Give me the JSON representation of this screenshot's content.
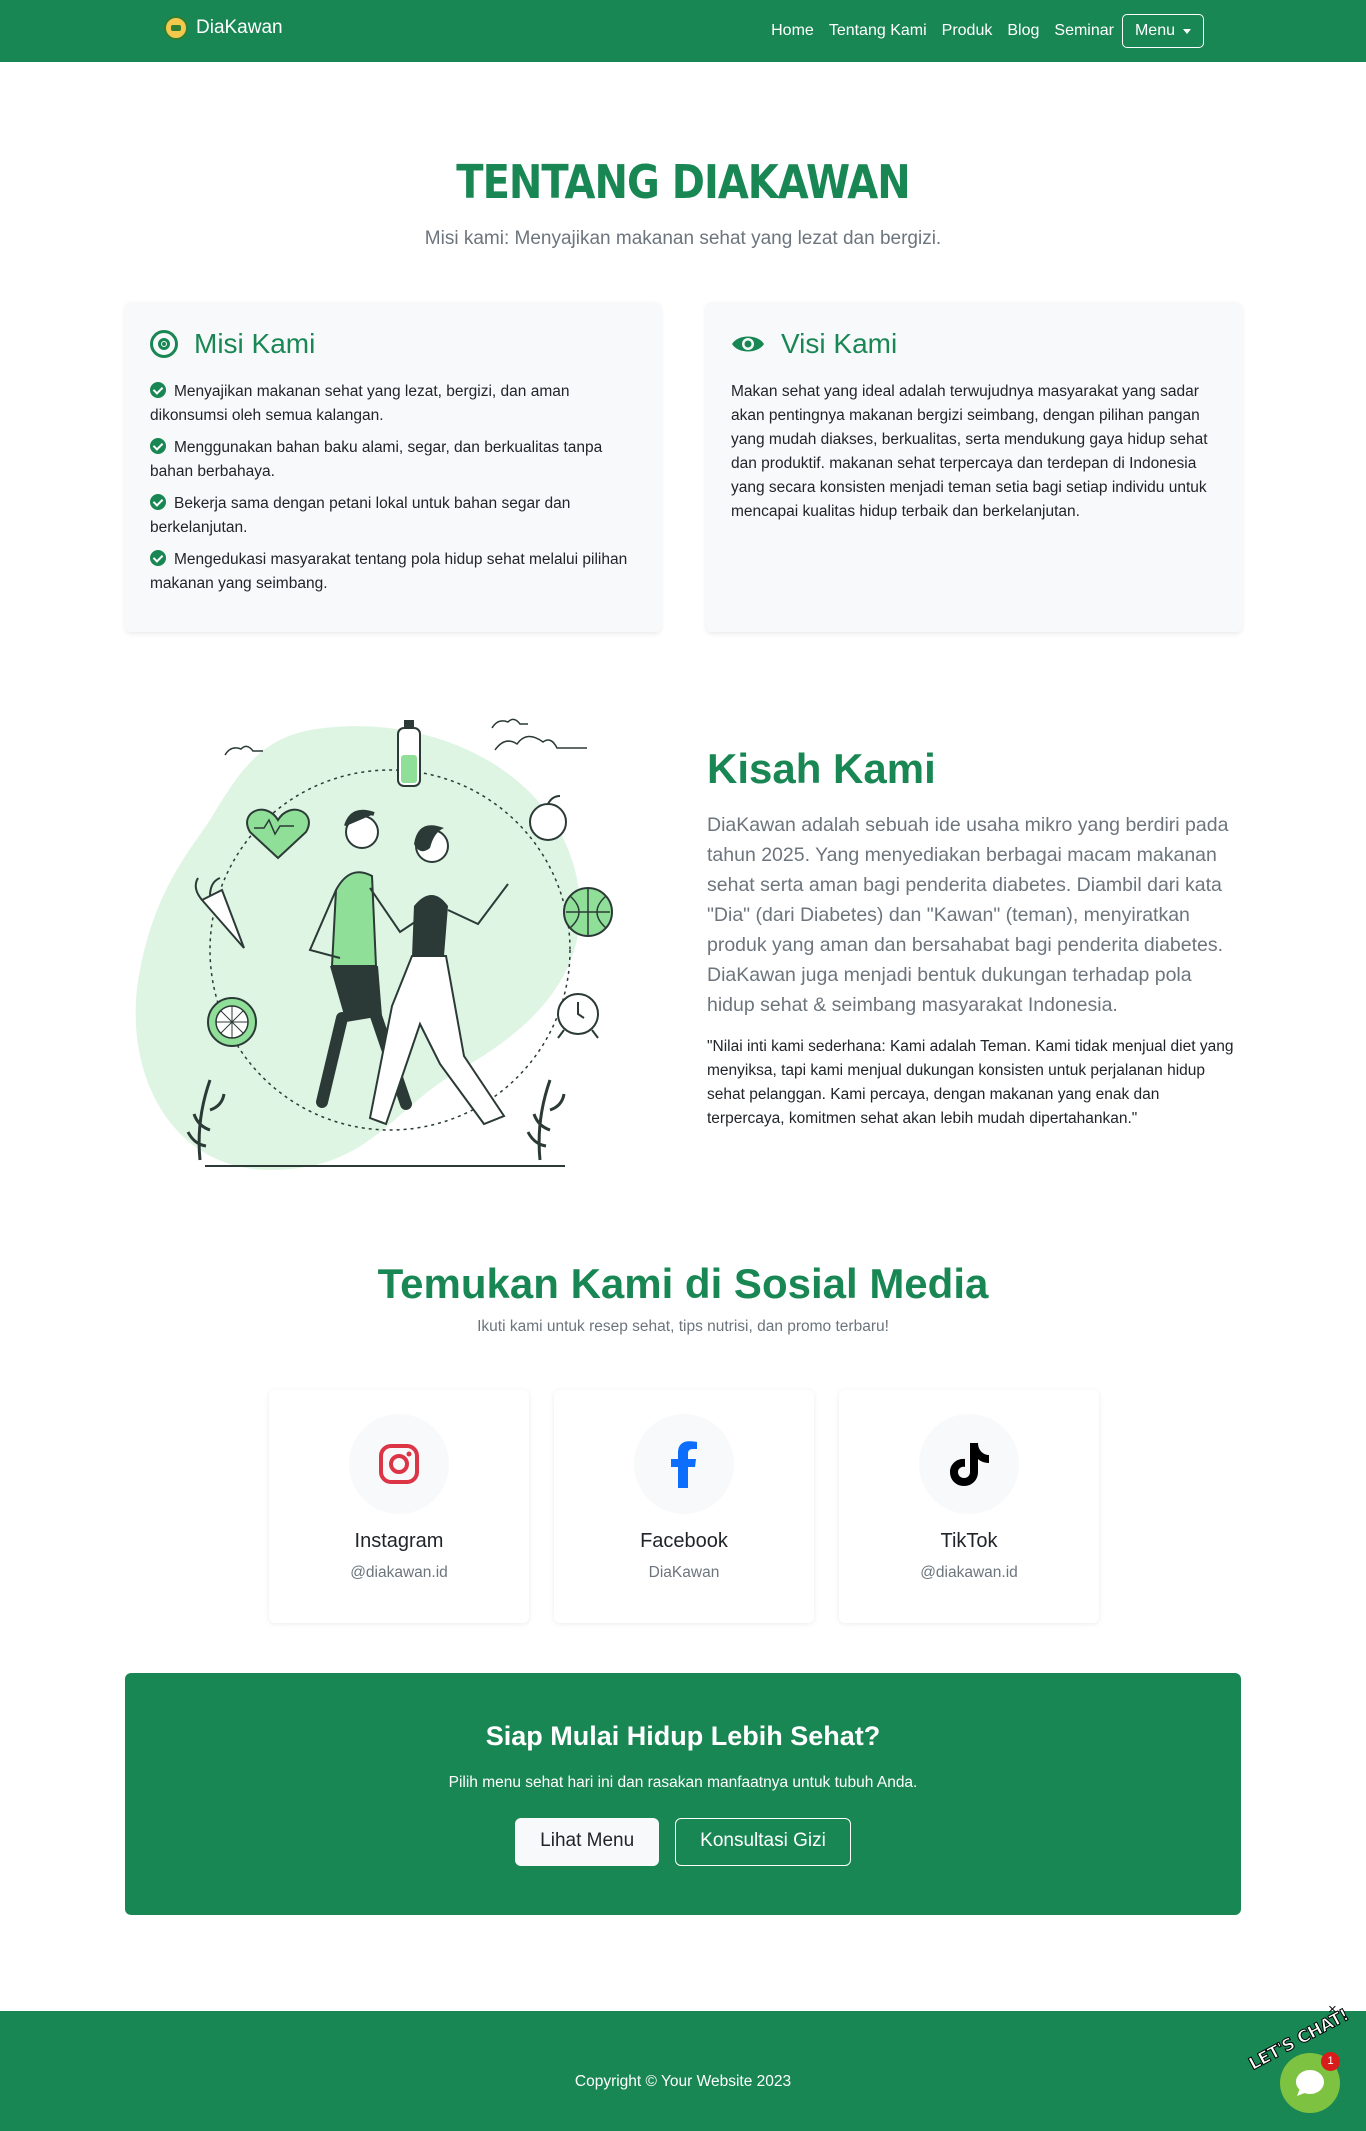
{
  "navbar": {
    "brand": "DiaKawan",
    "links": [
      "Home",
      "Tentang Kami",
      "Produk",
      "Blog",
      "Seminar"
    ],
    "menu_label": "Menu"
  },
  "hero": {
    "title": "TENTANG DIAKAWAN",
    "subtitle": "Misi kami: Menyajikan makanan sehat yang lezat dan bergizi."
  },
  "misi": {
    "title": "Misi Kami",
    "items": [
      "Menyajikan makanan sehat yang lezat, bergizi, dan aman dikonsumsi oleh semua kalangan.",
      "Menggunakan bahan baku alami, segar, dan berkualitas tanpa bahan berbahaya.",
      "Bekerja sama dengan petani lokal untuk bahan segar dan berkelanjutan.",
      "Mengedukasi masyarakat tentang pola hidup sehat melalui pilihan makanan yang seimbang."
    ]
  },
  "visi": {
    "title": "Visi Kami",
    "text": "Makan sehat yang ideal adalah terwujudnya masyarakat yang sadar akan pentingnya makanan bergizi seimbang, dengan pilihan pangan yang mudah diakses, berkualitas, serta mendukung gaya hidup sehat dan produktif. makanan sehat terpercaya dan terdepan di Indonesia yang secara konsisten menjadi teman setia bagi setiap individu untuk mencapai kualitas hidup terbaik dan berkelanjutan."
  },
  "story": {
    "title": "Kisah Kami",
    "paragraph": "DiaKawan adalah sebuah ide usaha mikro yang berdiri pada tahun 2025. Yang menyediakan berbagai macam makanan sehat serta aman bagi penderita diabetes. Diambil dari kata \"Dia\" (dari Diabetes) dan \"Kawan\" (teman), menyiratkan produk yang aman dan bersahabat bagi penderita diabetes. DiaKawan juga menjadi bentuk dukungan terhadap pola hidup sehat & seimbang masyarakat Indonesia.",
    "quote": "\"Nilai inti kami sederhana: Kami adalah Teman. Kami tidak menjual diet yang menyiksa, tapi kami menjual dukungan konsisten untuk perjalanan hidup sehat pelanggan. Kami percaya, dengan makanan yang enak dan terpercaya, komitmen sehat akan lebih mudah dipertahankan.\""
  },
  "social": {
    "title": "Temukan Kami di Sosial Media",
    "subtitle": "Ikuti kami untuk resep sehat, tips nutrisi, dan promo terbaru!",
    "cards": [
      {
        "name": "Instagram",
        "handle": "@diakawan.id",
        "icon": "instagram-icon",
        "color": "#dc3545"
      },
      {
        "name": "Facebook",
        "handle": "DiaKawan",
        "icon": "facebook-icon",
        "color": "#0d6efd"
      },
      {
        "name": "TikTok",
        "handle": "@diakawan.id",
        "icon": "tiktok-icon",
        "color": "#000000"
      }
    ]
  },
  "cta": {
    "title": "Siap Mulai Hidup Lebih Sehat?",
    "subtitle": "Pilih menu sehat hari ini dan rasakan manfaatnya untuk tubuh Anda.",
    "primary_label": "Lihat Menu",
    "secondary_label": "Konsultasi Gizi"
  },
  "footer": {
    "copyright": "Copyright © Your Website 2023"
  },
  "chat": {
    "label": "LET'S CHAT!",
    "badge_count": "1",
    "close_symbol": "×"
  },
  "colors": {
    "primary": "#198754",
    "muted": "#6c757d",
    "card_bg": "#f8f9fa",
    "illustration_blob": "#dff5e3",
    "chat_green": "#7ec242"
  }
}
